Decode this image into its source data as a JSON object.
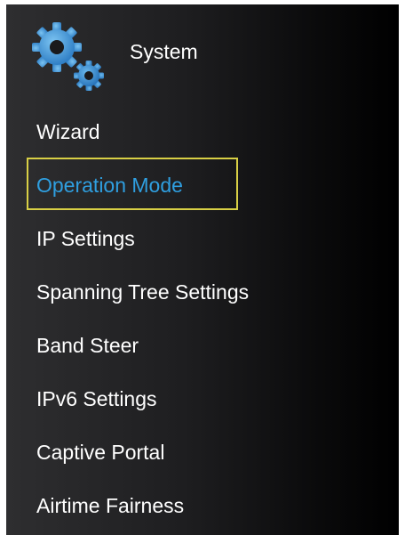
{
  "sidebar": {
    "header": {
      "title": "System",
      "icon": "gears-icon"
    },
    "items": [
      {
        "label": "Wizard",
        "selected": false
      },
      {
        "label": "Operation Mode",
        "selected": true
      },
      {
        "label": "IP Settings",
        "selected": false
      },
      {
        "label": "Spanning Tree Settings",
        "selected": false
      },
      {
        "label": "Band Steer",
        "selected": false
      },
      {
        "label": "IPv6 Settings",
        "selected": false
      },
      {
        "label": "Captive Portal",
        "selected": false
      },
      {
        "label": "Airtime Fairness",
        "selected": false
      }
    ]
  },
  "colors": {
    "selected_text": "#2f9fe0",
    "focus_border": "#d8cf45",
    "gear_blue": "#3d8fd1"
  }
}
